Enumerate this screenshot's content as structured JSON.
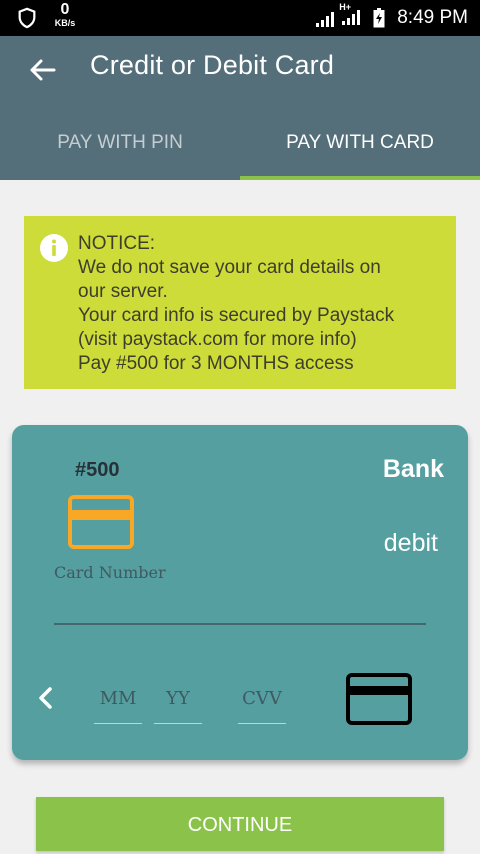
{
  "status_bar": {
    "speed_value": "0",
    "speed_unit": "KB/s",
    "network_label": "H+",
    "time": "8:49 PM",
    "icons": [
      "shield-icon",
      "signal-icon",
      "battery-icon"
    ]
  },
  "app_bar": {
    "title": "Credit or Debit Card",
    "back_icon": "arrow-left-icon",
    "background_color": "#546e7a"
  },
  "tabs": [
    {
      "label": "PAY WITH PIN",
      "active": false
    },
    {
      "label": "PAY WITH CARD",
      "active": true
    }
  ],
  "notice": {
    "icon": "info-icon",
    "lines": [
      "NOTICE:",
      "We do not save your card details on",
      "our server.",
      "Your card info is secured by Paystack",
      "(visit paystack.com for more info)",
      "Pay #500 for 3 MONTHS access"
    ],
    "background_color": "#cddc39"
  },
  "card": {
    "amount": "#500",
    "bank": "Bank",
    "card_type": "debit",
    "card_number_placeholder": "Card Number",
    "expiry_month_placeholder": "MM",
    "expiry_year_placeholder": "YY",
    "cvv_placeholder": "CVV",
    "background_color": "#559fa0"
  },
  "continue_label": "CONTINUE",
  "accent_color": "#8bc34a"
}
